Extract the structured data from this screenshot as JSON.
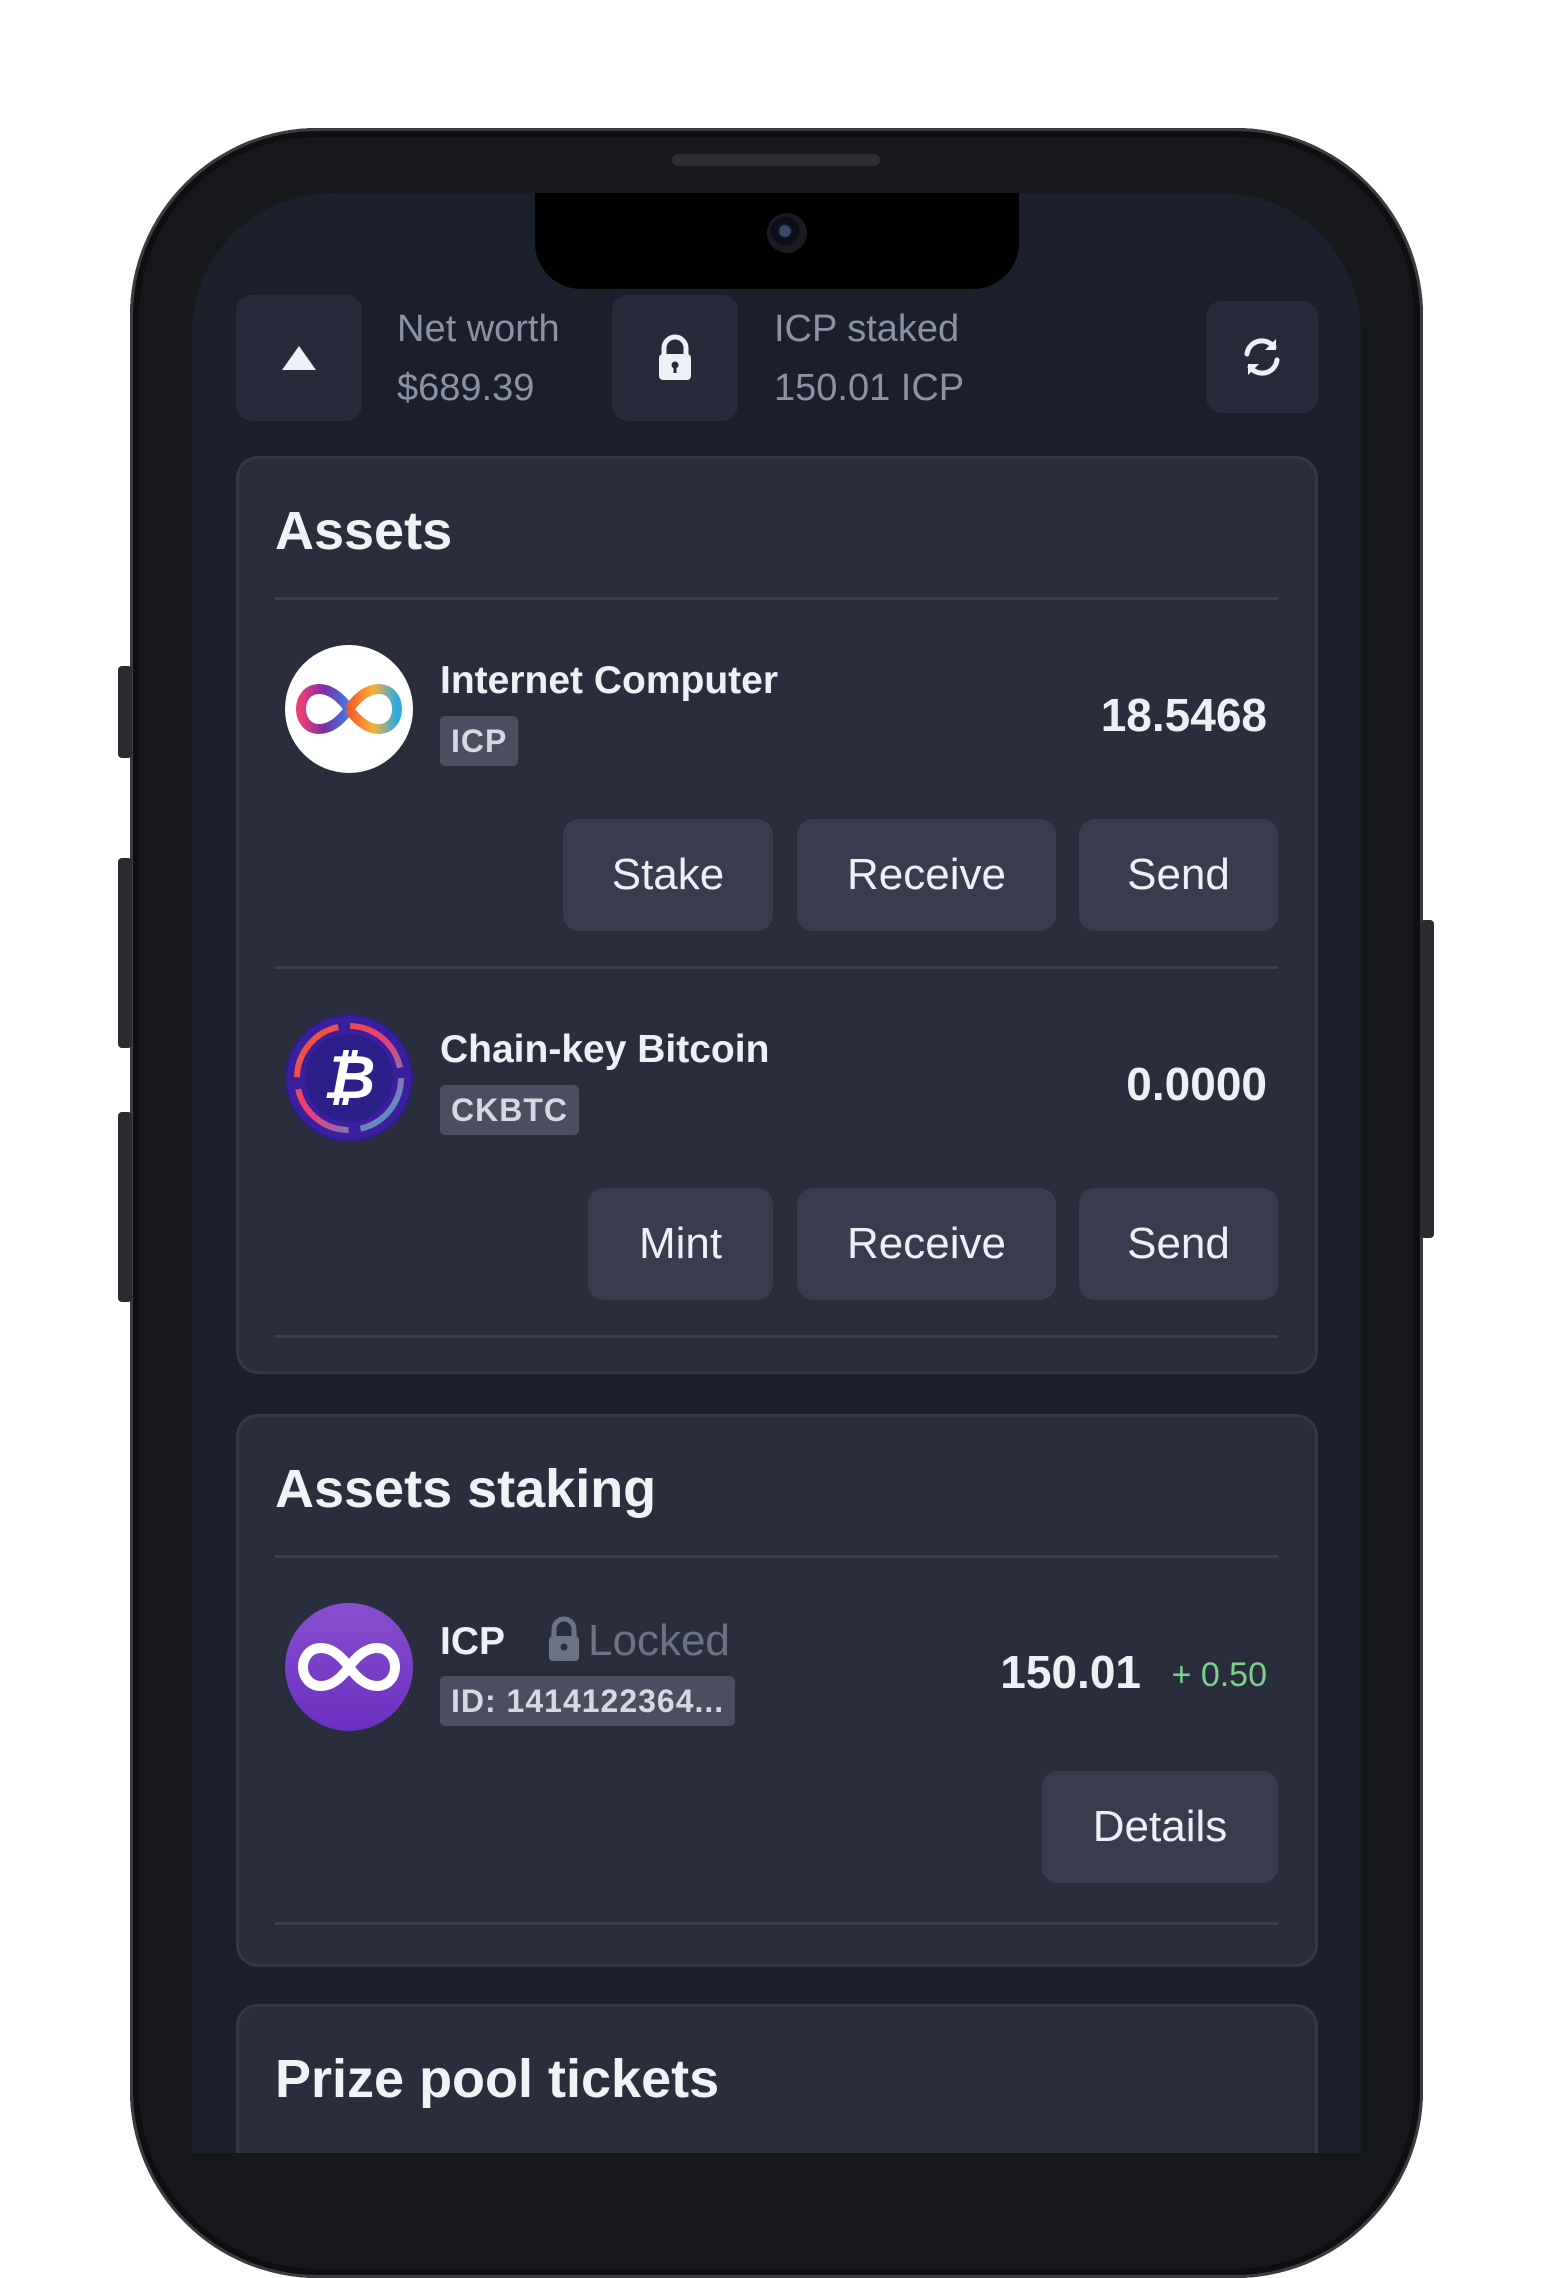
{
  "summary": {
    "net_worth_label": "Net worth",
    "net_worth_value": "$689.39",
    "staked_label": "ICP staked",
    "staked_value": "150.01 ICP",
    "collapse_icon": "triangle-up-icon",
    "lock_icon": "lock-icon",
    "refresh_icon": "refresh-icon"
  },
  "assets": {
    "title": "Assets",
    "items": [
      {
        "name": "Internet Computer",
        "symbol": "ICP",
        "amount": "18.5468",
        "icon": "icp-logo-icon",
        "actions": [
          "Stake",
          "Receive",
          "Send"
        ]
      },
      {
        "name": "Chain-key Bitcoin",
        "symbol": "CKBTC",
        "amount": "0.0000",
        "icon": "ckbtc-logo-icon",
        "actions": [
          "Mint",
          "Receive",
          "Send"
        ]
      }
    ]
  },
  "staking": {
    "title": "Assets staking",
    "items": [
      {
        "name": "ICP",
        "status": "Locked",
        "id": "ID: 1414122364...",
        "amount": "150.01",
        "change": "+ 0.50",
        "icon": "icp-staking-logo-icon",
        "action": "Details"
      }
    ]
  },
  "prize_pool": {
    "title": "Prize pool tickets"
  },
  "colors": {
    "background": "#1b1e2b",
    "card": "#2a2d3c",
    "button": "#383c4e",
    "positive": "#7ccf8e",
    "muted_text": "#8b92a6"
  }
}
